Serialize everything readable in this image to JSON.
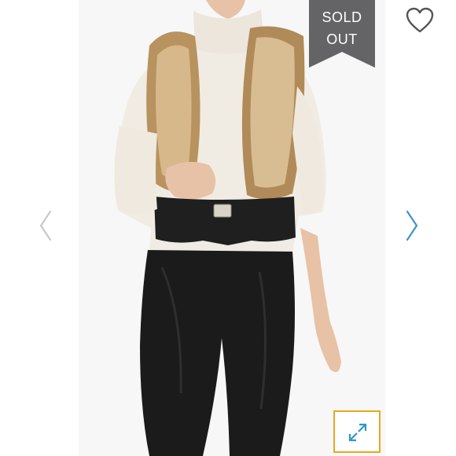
{
  "badge": {
    "line1": "SOLD",
    "line2": "OUT"
  },
  "icons": {
    "like": "heart-icon",
    "previous": "chevron-left-icon",
    "next": "chevron-right-icon",
    "expand": "expand-arrows-icon"
  },
  "colors": {
    "badge": "#646466",
    "nav_inactive": "#c8c8c8",
    "nav_active": "#3c95c8",
    "expand_border": "#e6a820",
    "expand_icon": "#2e97c9",
    "heart_outline": "#555555"
  }
}
